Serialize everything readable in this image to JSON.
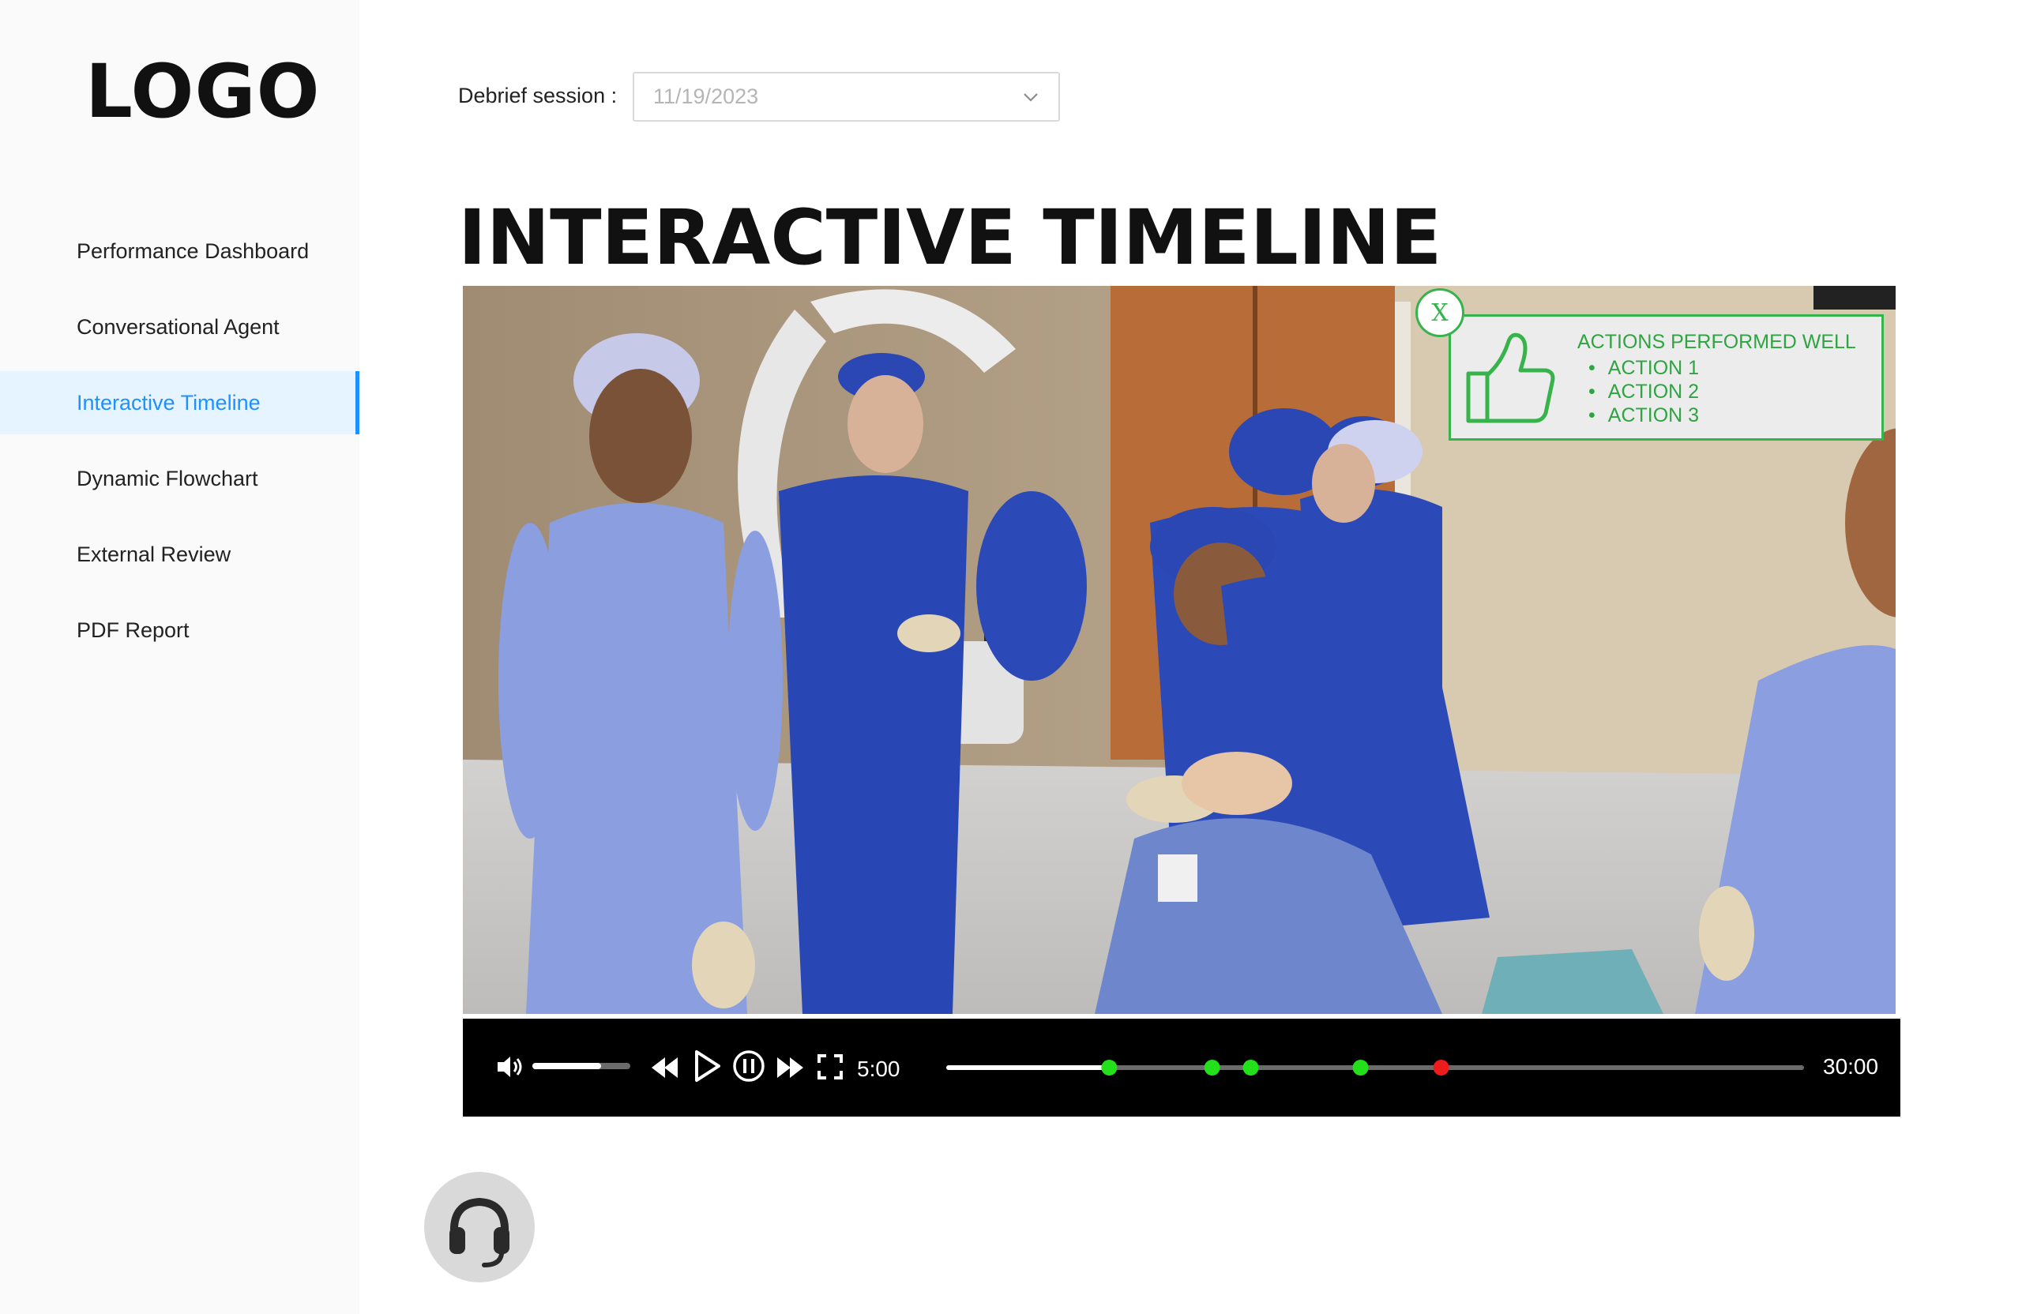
{
  "sidebar": {
    "logo": "LOGO",
    "items": [
      {
        "label": "Performance Dashboard"
      },
      {
        "label": "Conversational Agent"
      },
      {
        "label": "Interactive Timeline"
      },
      {
        "label": "Dynamic Flowchart"
      },
      {
        "label": "External Review"
      },
      {
        "label": "PDF Report"
      }
    ],
    "active_index": 2
  },
  "header": {
    "session_label": "Debrief session :",
    "session_value": "11/19/2023"
  },
  "main": {
    "title": "INTERACTIVE TIMELINE"
  },
  "popup": {
    "close_label": "X",
    "title": "ACTIONS PERFORMED WELL",
    "actions": [
      "ACTION 1",
      "ACTION 2",
      "ACTION 3"
    ],
    "icon": "thumbs-up-icon"
  },
  "player": {
    "current_time": "5:00",
    "total_time": "30:00",
    "volume_level": 0.7,
    "progress": 0.19,
    "markers": [
      {
        "position": 0.19,
        "status": "good"
      },
      {
        "position": 0.31,
        "status": "good"
      },
      {
        "position": 0.355,
        "status": "good"
      },
      {
        "position": 0.483,
        "status": "good"
      },
      {
        "position": 0.577,
        "status": "bad"
      }
    ],
    "colors": {
      "good": "#22e01a",
      "bad": "#ee1c1c",
      "played": "#ffffff",
      "track": "#6b6b6b"
    }
  },
  "colors": {
    "accent": "#1e90ff",
    "active_bg": "#e6f4ff",
    "popup_green": "#36b34a",
    "support_bg": "#d9d9d9"
  }
}
